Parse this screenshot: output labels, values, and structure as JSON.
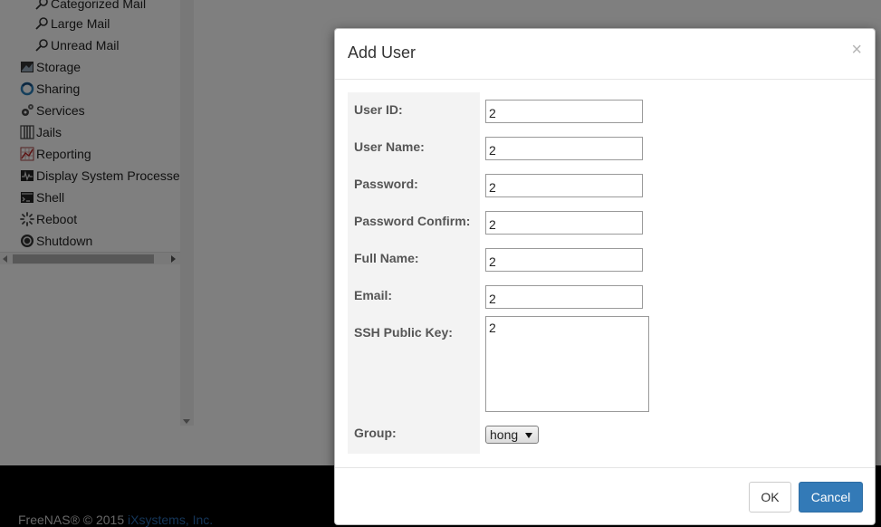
{
  "sidebar": {
    "items": [
      {
        "label": "Categorized Mail",
        "icon": "search-icon"
      },
      {
        "label": "Large Mail",
        "icon": "search-icon"
      },
      {
        "label": "Unread Mail",
        "icon": "search-icon"
      },
      {
        "label": "Storage",
        "icon": "storage-icon"
      },
      {
        "label": "Sharing",
        "icon": "sharing-icon"
      },
      {
        "label": "Services",
        "icon": "services-icon"
      },
      {
        "label": "Jails",
        "icon": "jails-icon"
      },
      {
        "label": "Reporting",
        "icon": "reporting-icon"
      },
      {
        "label": "Display System Processes",
        "icon": "display-processes-icon"
      },
      {
        "label": "Shell",
        "icon": "shell-icon"
      },
      {
        "label": "Reboot",
        "icon": "reboot-icon"
      },
      {
        "label": "Shutdown",
        "icon": "shutdown-icon"
      }
    ]
  },
  "footer": {
    "copyright": "FreeNAS® © 2015 ",
    "link": "iXsystems, Inc."
  },
  "dialog": {
    "title": "Add User",
    "close_label": "×",
    "fields": {
      "user_id": {
        "label": "User ID:",
        "value": "2"
      },
      "user_name": {
        "label": "User Name:",
        "value": "2"
      },
      "password": {
        "label": "Password:",
        "value": "2"
      },
      "password_confirm": {
        "label": "Password Confirm:",
        "value": "2"
      },
      "full_name": {
        "label": "Full Name:",
        "value": "2"
      },
      "email": {
        "label": "Email:",
        "value": "2"
      },
      "ssh_key": {
        "label": "SSH Public Key:",
        "value": "2"
      },
      "group": {
        "label": "Group:",
        "value": "hong"
      }
    },
    "ok_label": "OK",
    "cancel_label": "Cancel"
  },
  "colors": {
    "primary": "#337ab7",
    "overlay": "#000000",
    "label_bg": "#f3f3f3"
  }
}
